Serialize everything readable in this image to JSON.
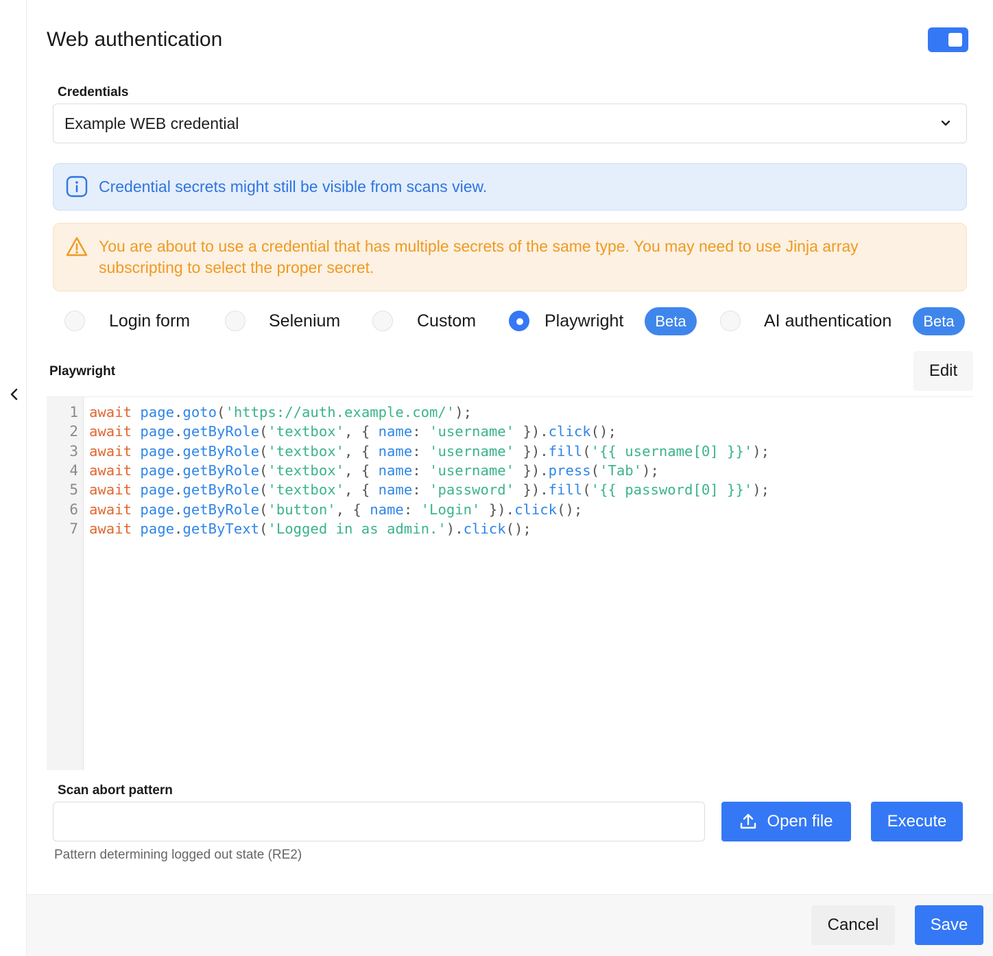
{
  "header": {
    "title": "Web authentication",
    "toggle_on": true
  },
  "credentials": {
    "label": "Credentials",
    "selected": "Example WEB credential"
  },
  "alerts": {
    "info": {
      "icon": "info-icon",
      "text": "Credential secrets might still be visible from scans view."
    },
    "warning": {
      "icon": "warning-icon",
      "text": "You are about to use a credential that has multiple secrets of the same type. You may need to use Jinja array subscripting to select the proper secret."
    }
  },
  "auth_methods": {
    "selected": "Playwright",
    "options": [
      {
        "label": "Login form",
        "badge": ""
      },
      {
        "label": "Selenium",
        "badge": ""
      },
      {
        "label": "Custom",
        "badge": ""
      },
      {
        "label": "Playwright",
        "badge": "Beta"
      },
      {
        "label": "AI authentication",
        "badge": "Beta"
      }
    ]
  },
  "playwright": {
    "label": "Playwright",
    "edit_label": "Edit",
    "code_lines": [
      "await page.goto('https://auth.example.com/');",
      "await page.getByRole('textbox', { name: 'username' }).click();",
      "await page.getByRole('textbox', { name: 'username' }).fill('{{ username[0] }}');",
      "await page.getByRole('textbox', { name: 'username' }).press('Tab');",
      "await page.getByRole('textbox', { name: 'password' }).fill('{{ password[0] }}');",
      "await page.getByRole('button', { name: 'Login' }).click();",
      "await page.getByText('Logged in as admin.').click();"
    ]
  },
  "scan_abort": {
    "label": "Scan abort pattern",
    "value": "",
    "placeholder": "",
    "hint": "Pattern determining logged out state (RE2)",
    "open_file_label": "Open file",
    "execute_label": "Execute"
  },
  "footer": {
    "cancel_label": "Cancel",
    "save_label": "Save"
  },
  "colors": {
    "accent": "#3478f6",
    "info_text": "#2f75e0",
    "warning_text": "#ef9a23",
    "keyword": "#e2662f",
    "string": "#3bb48a"
  }
}
